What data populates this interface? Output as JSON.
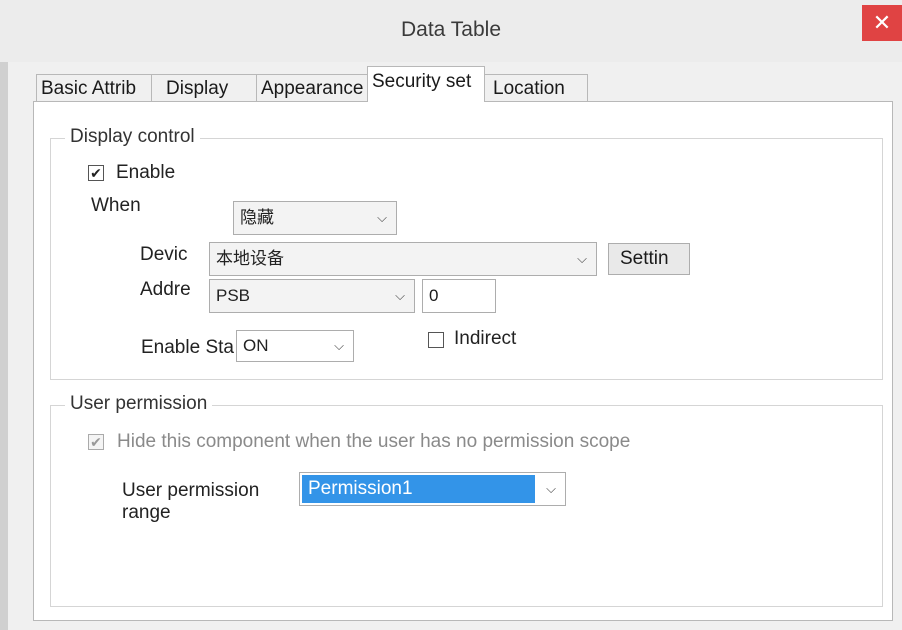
{
  "window": {
    "title": "Data Table",
    "close_glyph": "✕"
  },
  "tabs": [
    {
      "label": "Basic Attrib"
    },
    {
      "label": "Display"
    },
    {
      "label": "Appearance"
    },
    {
      "label": "Security set"
    },
    {
      "label": "Location"
    }
  ],
  "active_tab_index": 3,
  "display_control": {
    "title": "Display control",
    "enable_label": "Enable",
    "enable_checked": true,
    "when_label": "When",
    "when_value": "隐藏",
    "device_label": "Devic",
    "device_value": "本地设备",
    "settings_button": "Settin",
    "address_label": "Addre",
    "address_type": "PSB",
    "address_value": "0",
    "enable_state_label": "Enable Sta",
    "enable_state_value": "ON",
    "indirect_label": "Indirect",
    "indirect_checked": false
  },
  "user_permission": {
    "title": "User permission",
    "hide_label": "Hide this component when the user has no permission scope",
    "hide_checked": true,
    "range_label_line1": "User permission",
    "range_label_line2": "range",
    "range_value": "Permission1"
  },
  "icons": {
    "check": "✔",
    "chevron": "⌵"
  }
}
